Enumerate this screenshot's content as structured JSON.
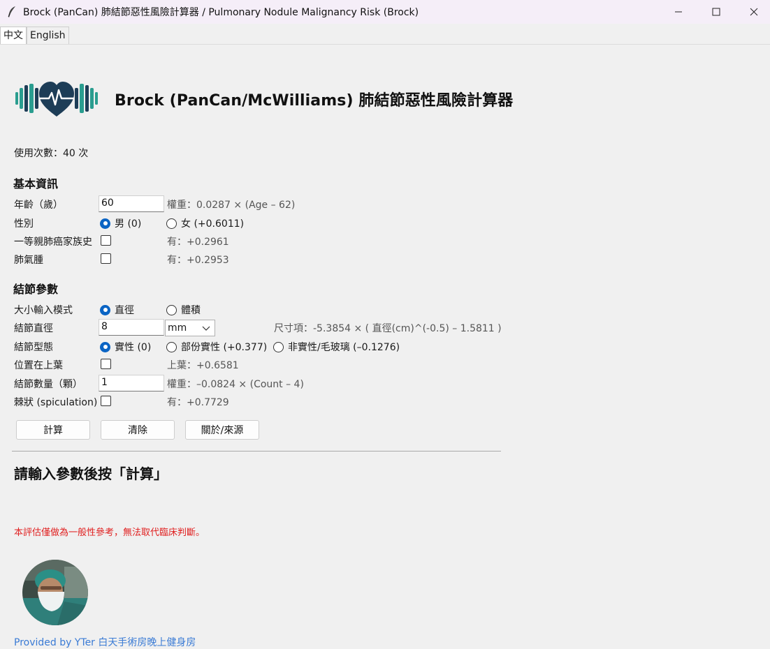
{
  "window": {
    "title": "Brock (PanCan) 肺結節惡性風險計算器  /  Pulmonary Nodule Malignancy Risk (Brock)"
  },
  "tabs": [
    {
      "label": "中文",
      "active": true
    },
    {
      "label": "English",
      "active": false
    }
  ],
  "header": {
    "title": "Brock (PanCan/McWilliams) 肺結節惡性風險計算器",
    "logo_icon": "heart-dumbbell-logo",
    "logo_color": "#1d3d57",
    "logo_accent": "#2a9d8f"
  },
  "usage": "使用次數：40 次",
  "basic": {
    "section_title": "基本資訊",
    "age": {
      "label": "年齡（歲）",
      "value": "60",
      "hint": "權重：0.0287 × (Age – 62)"
    },
    "sex": {
      "label": "性別",
      "male": "男 (0)",
      "female": "女 (+0.6011)",
      "selected": "male"
    },
    "family_history": {
      "label": "一等親肺癌家族史",
      "hint": "有：+0.2961",
      "checked": false
    },
    "emphysema": {
      "label": "肺氣腫",
      "hint": "有：+0.2953",
      "checked": false
    }
  },
  "nodule": {
    "section_title": "結節參數",
    "size_mode": {
      "label": "大小輸入模式",
      "opt_diameter": "直徑",
      "opt_volume": "體積",
      "selected": "diameter"
    },
    "diameter": {
      "label": "結節直徑",
      "value": "8",
      "unit": "mm",
      "hint": "尺寸項：-5.3854 × ( 直徑(cm)^(-0.5) – 1.5811 )"
    },
    "type": {
      "label": "結節型態",
      "opt_solid": "實性 (0)",
      "opt_part": "部份實性 (+0.377)",
      "opt_nonsolid": "非實性/毛玻璃 (–0.1276)",
      "selected": "solid"
    },
    "upper_lobe": {
      "label": "位置在上葉",
      "hint": "上葉：+0.6581",
      "checked": false
    },
    "count": {
      "label": "結節數量（顆）",
      "value": "1",
      "hint": "權重：–0.0824 × (Count – 4)"
    },
    "spiculation": {
      "label": "棘狀 (spiculation)",
      "hint": "有：+0.7729",
      "checked": false
    }
  },
  "buttons": {
    "calculate": "計算",
    "clear": "清除",
    "about": "關於/來源"
  },
  "result": "請輸入參數後按「計算」",
  "disclaimer": "本評估僅做為一般性參考，無法取代臨床判斷。",
  "credit": "Provided by YTer 白天手術房晚上健身房",
  "colors": {
    "accent": "#0a64c4",
    "disclaimer": "#e02020",
    "link": "#3a7bd5"
  }
}
